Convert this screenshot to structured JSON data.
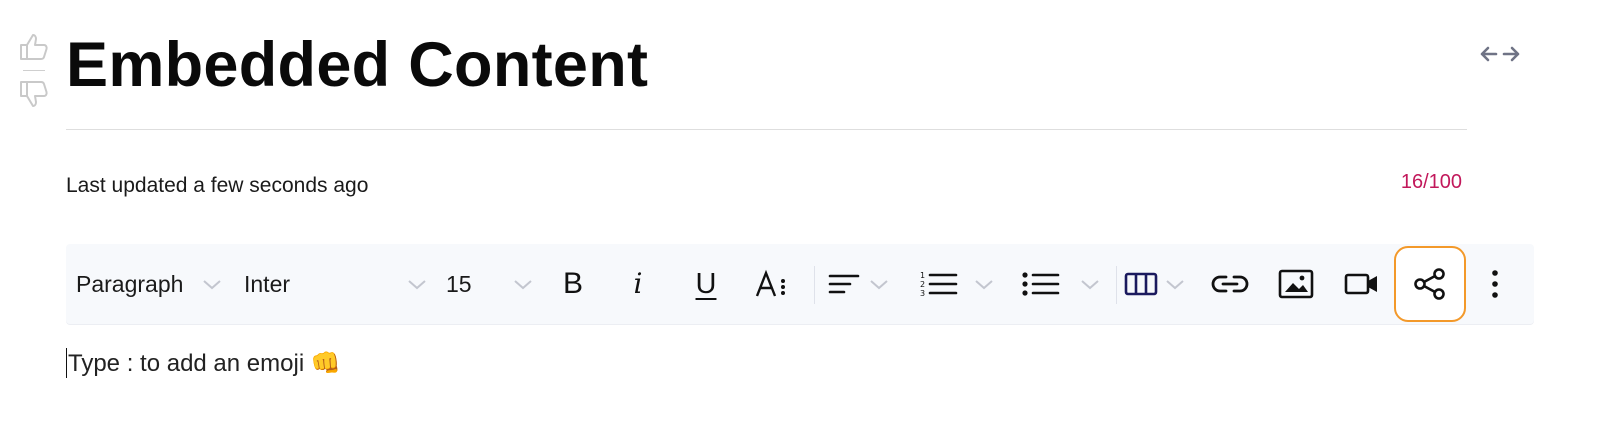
{
  "page": {
    "title": "Embedded Content",
    "updated": "Last updated a few seconds ago",
    "counter": "16/100",
    "counter_color": "#c2185b"
  },
  "vote": {
    "up_icon": "thumbs-up-icon",
    "down_icon": "thumbs-down-icon"
  },
  "toolbar": {
    "block_type": "Paragraph",
    "font_family": "Inter",
    "font_size": "15",
    "bold_label": "B",
    "italic_label": "i",
    "underline_label": "U",
    "active_color": "#f3992a",
    "icons": {
      "text_format": "text-format-icon",
      "align": "align-left-icon",
      "numbered_list": "numbered-list-icon",
      "bullet_list": "bullet-list-icon",
      "columns": "columns-icon",
      "link": "link-icon",
      "image": "image-icon",
      "video": "video-icon",
      "embed": "share-icon",
      "more": "more-vertical-icon"
    }
  },
  "editor": {
    "placeholder": "Type : to add an emoji 👊"
  }
}
